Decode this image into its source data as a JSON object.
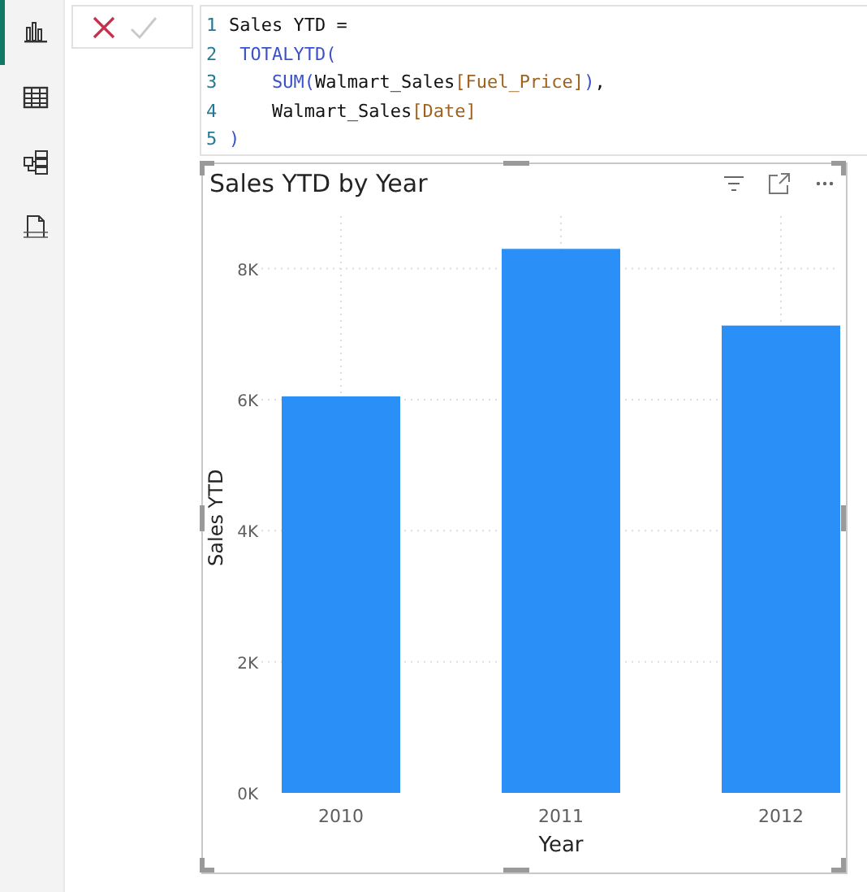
{
  "sidebar": {
    "items": [
      {
        "kind": "report",
        "selected": true
      },
      {
        "kind": "table",
        "selected": false
      },
      {
        "kind": "model",
        "selected": false
      },
      {
        "kind": "dax",
        "selected": false
      }
    ]
  },
  "formula_bar": {
    "lines": [
      {
        "number": "1",
        "tokens": [
          {
            "kind": "text",
            "text": "Sales YTD ="
          }
        ]
      },
      {
        "number": "2",
        "tokens": [
          {
            "kind": "function",
            "text": " TOTALYTD("
          }
        ]
      },
      {
        "number": "3",
        "tokens": [
          {
            "kind": "function",
            "text": "    SUM("
          },
          {
            "kind": "text",
            "text": "Walmart_Sales"
          },
          {
            "kind": "column",
            "text": "[Fuel_Price]"
          },
          {
            "kind": "function",
            "text": ")"
          },
          {
            "kind": "text",
            "text": ","
          }
        ]
      },
      {
        "number": "4",
        "tokens": [
          {
            "kind": "text",
            "text": "    Walmart_Sales"
          },
          {
            "kind": "column",
            "text": "[Date]"
          }
        ]
      },
      {
        "number": "5",
        "tokens": [
          {
            "kind": "function",
            "text": ")"
          }
        ]
      }
    ]
  },
  "visual": {
    "title": "Sales YTD by Year",
    "chart_data": {
      "type": "bar",
      "xlabel": "Year",
      "ylabel": "Sales YTD",
      "categories": [
        "2010",
        "2011",
        "2012"
      ],
      "series": [
        {
          "color": "#2b8ff8",
          "values": [
            6050,
            8300,
            7130
          ]
        }
      ],
      "grid": true,
      "ylim": [
        0,
        8800
      ],
      "yticks": [
        {
          "value": 0,
          "label": "0K"
        },
        {
          "value": 2000,
          "label": "2K"
        },
        {
          "value": 4000,
          "label": "4K"
        },
        {
          "value": 6000,
          "label": "6K"
        },
        {
          "value": 8000,
          "label": "8K"
        }
      ]
    }
  }
}
